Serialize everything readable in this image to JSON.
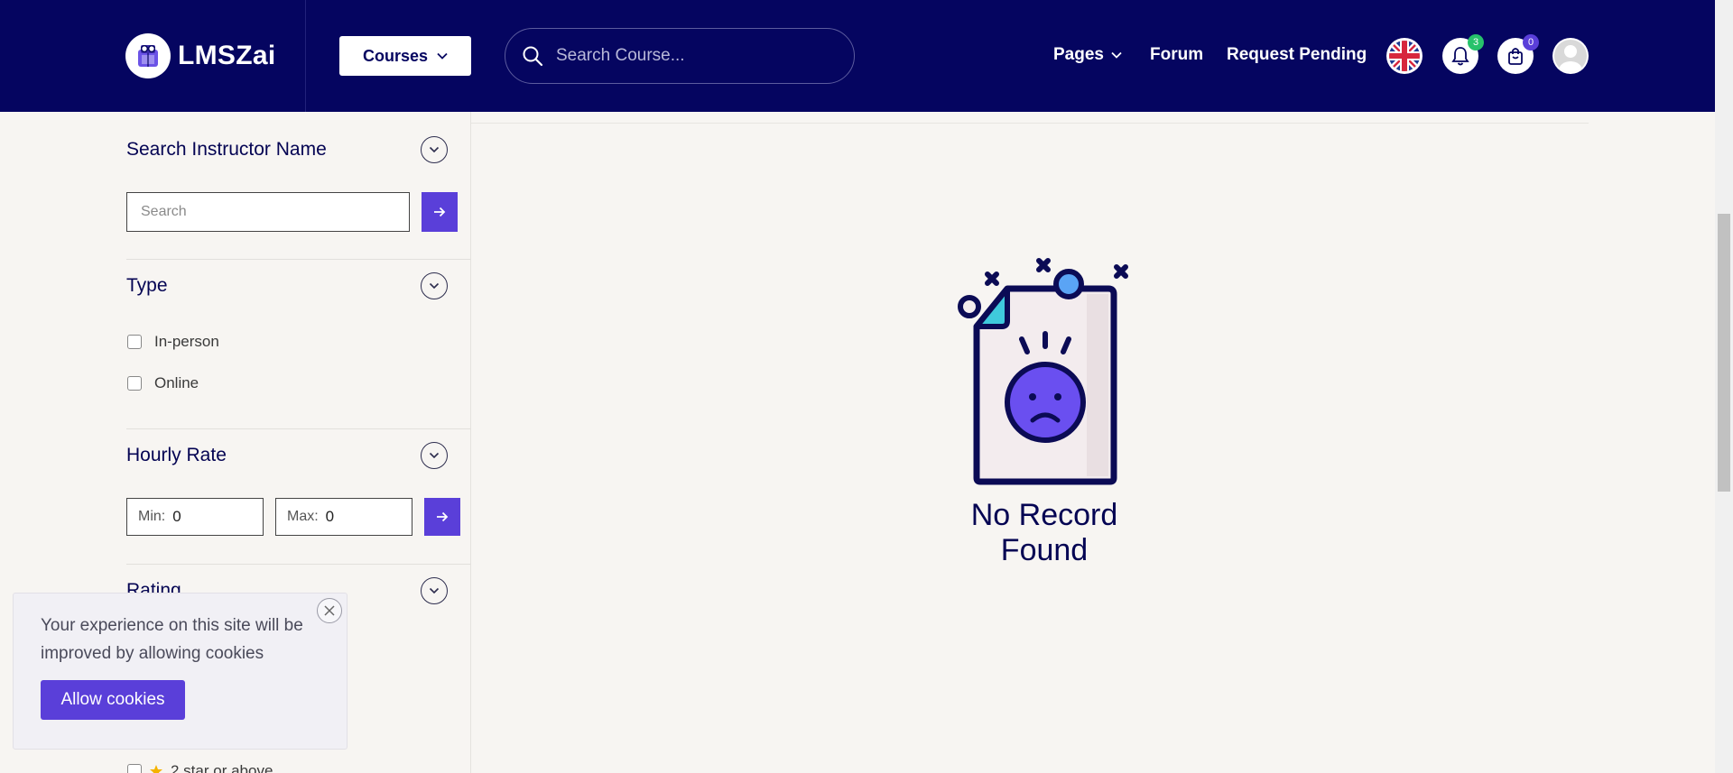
{
  "header": {
    "logo_text": "LMSZai",
    "courses_label": "Courses",
    "search_placeholder": "Search Course...",
    "nav": {
      "pages": "Pages",
      "forum": "Forum",
      "request_pending": "Request Pending"
    },
    "notification_count": "3",
    "cart_count": "0",
    "colors": {
      "bg": "#050560",
      "accent": "#5a3fd9",
      "notify_badge": "#27c26b",
      "cart_badge": "#5a3fd9"
    }
  },
  "sidebar": {
    "instructor": {
      "title": "Search Instructor Name",
      "placeholder": "Search"
    },
    "type": {
      "title": "Type",
      "options": [
        "In-person",
        "Online"
      ]
    },
    "hourly_rate": {
      "title": "Hourly Rate",
      "min_label": "Min:",
      "min_value": "0",
      "max_label": "Max:",
      "max_value": "0"
    },
    "rating": {
      "title": "Rating",
      "peek_option": "2 star or above"
    }
  },
  "main": {
    "empty_message": "No Record Found"
  },
  "cookie": {
    "message": "Your experience on this site will be improved by allowing cookies",
    "button_label": "Allow cookies"
  }
}
